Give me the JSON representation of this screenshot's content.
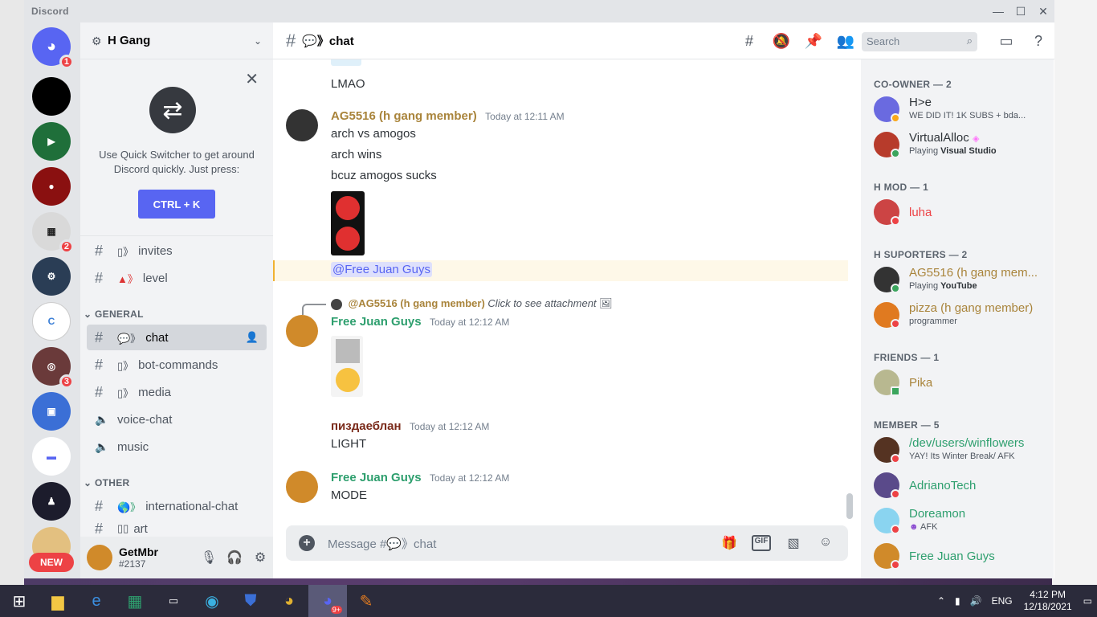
{
  "window": {
    "title": "Discord"
  },
  "servers": [
    {
      "name": "home",
      "color": "#5865f2",
      "badge": "1",
      "glyph": "◉"
    },
    {
      "name": "server-black",
      "color": "#000000",
      "badge": "",
      "glyph": ""
    },
    {
      "name": "server-palestine",
      "color": "#1f6f3a",
      "badge": "",
      "glyph": "▶"
    },
    {
      "name": "server-red",
      "color": "#8a1010",
      "badge": "",
      "glyph": "●"
    },
    {
      "name": "server-pixel",
      "color": "#dcdcdc",
      "badge": "2",
      "glyph": "▦"
    },
    {
      "name": "server-python",
      "color": "#2a3d55",
      "badge": "",
      "glyph": "🐍"
    },
    {
      "name": "server-c",
      "color": "#ffffff",
      "badge": "",
      "glyph": "C"
    },
    {
      "name": "server-disc",
      "color": "#7a3a3a",
      "badge": "3",
      "glyph": "◎"
    },
    {
      "name": "server-twitch",
      "color": "#3b6fd6",
      "badge": "",
      "glyph": "▣"
    },
    {
      "name": "server-folder",
      "color": "#ffffff",
      "badge": "",
      "glyph": "▬"
    },
    {
      "name": "server-art",
      "color": "#1c1c2c",
      "badge": "",
      "glyph": "♟"
    }
  ],
  "new_pill": "NEW",
  "guild": {
    "name": "H Gang",
    "quick_switcher": {
      "text": "Use Quick Switcher to get around Discord quickly. Just press:",
      "button": "CTRL + K"
    },
    "channels_top": [
      {
        "name": "invites",
        "emoji": "▯》"
      },
      {
        "name": "level",
        "emoji": "▲》"
      }
    ],
    "categories": [
      {
        "name": "GENERAL"
      },
      {
        "name": "OTHER"
      }
    ],
    "general_channels": [
      {
        "name": "chat",
        "emoji": "💬》",
        "type": "text"
      },
      {
        "name": "bot-commands",
        "emoji": "▯》",
        "type": "text"
      },
      {
        "name": "media",
        "emoji": "▯》",
        "type": "text"
      },
      {
        "name": "voice-chat",
        "emoji": "",
        "type": "voice"
      },
      {
        "name": "music",
        "emoji": "",
        "type": "voice"
      }
    ],
    "other_channels": [
      {
        "name": "international-chat",
        "emoji": "🌎》",
        "type": "text"
      },
      {
        "name": "art",
        "emoji": "▯▯",
        "type": "text"
      }
    ]
  },
  "user": {
    "name": "GetMbr",
    "tag": "#2137"
  },
  "header": {
    "channel": "💬》chat",
    "search_placeholder": "Search"
  },
  "messages": [
    {
      "author": "",
      "time": "",
      "lines": [
        "LMAO"
      ]
    },
    {
      "author": "AG5516 (h gang member)",
      "color": "#a9843b",
      "time": "Today at 12:11 AM",
      "lines": [
        "arch vs amogos",
        "arch wins",
        "bcuz amogos sucks"
      ]
    },
    {
      "mention": "@Free Juan Guys"
    },
    {
      "reply_author": "@AG5516 (h gang member)",
      "reply_text": "Click to see attachment"
    },
    {
      "author": "Free Juan Guys",
      "color": "#2e9f6e",
      "time": "Today at 12:12 AM",
      "lines": []
    },
    {
      "author": "пиздаеблан",
      "color": "#7a2a1a",
      "time": "Today at 12:12 AM",
      "lines": [
        "LIGHT"
      ]
    },
    {
      "author": "Free Juan Guys",
      "color": "#2e9f6e",
      "time": "Today at 12:12 AM",
      "lines": [
        "MODE"
      ]
    }
  ],
  "composer": {
    "placeholder": "Message #💬》chat"
  },
  "members": {
    "categories": [
      "CO-OWNER — 2",
      "H MOD — 1",
      "H SUPORTERS — 2",
      "FRIENDS — 1",
      "MEMBER — 5"
    ],
    "list": [
      {
        "name": "H>e",
        "status": "WE DID IT! 1K SUBS + bda...",
        "color": "#2e3338",
        "ava": "#6a6ae0",
        "presence": "#faa81a"
      },
      {
        "name": "VirtualAlloc",
        "status_prefix": "Playing ",
        "status_bold": "Visual Studio",
        "color": "#2e3338",
        "ava": "#b73b2b",
        "presence": "#3ba55d"
      },
      {
        "name": "luha",
        "status": "",
        "color": "#ed4245",
        "ava": "#c44",
        "presence": "#ed4245"
      },
      {
        "name": "AG5516 (h gang mem...",
        "status_prefix": "Playing ",
        "status_bold": "YouTube",
        "color": "#a9843b",
        "ava": "#333",
        "presence": "#3ba55d"
      },
      {
        "name": "pizza (h gang member)",
        "status": "programmer",
        "color": "#a9843b",
        "ava": "#e07a20",
        "presence": "#ed4245"
      },
      {
        "name": "Pika",
        "status": "",
        "color": "#a9843b",
        "ava": "#b8b890",
        "presence": "#3ba55d"
      },
      {
        "name": "/dev/users/winflowers",
        "status": "YAY! Its Winter Break/ AFK",
        "color": "#2e9f6e",
        "ava": "#553322",
        "presence": "#ed4245"
      },
      {
        "name": "AdrianoTech",
        "status": "",
        "color": "#2e9f6e",
        "ava": "#5a4a8a",
        "presence": "#ed4245"
      },
      {
        "name": "Doreamon",
        "status": "AFK",
        "color": "#2e9f6e",
        "ava": "#8ad4f0",
        "presence": "#ed4245"
      },
      {
        "name": "Free Juan Guys",
        "status": "",
        "color": "#2e9f6e",
        "ava": "#d08a2a",
        "presence": "#ed4245"
      }
    ]
  },
  "taskbar": {
    "lang": "ENG",
    "time": "4:12 PM",
    "date": "12/18/2021",
    "discord_badge": "9+"
  }
}
